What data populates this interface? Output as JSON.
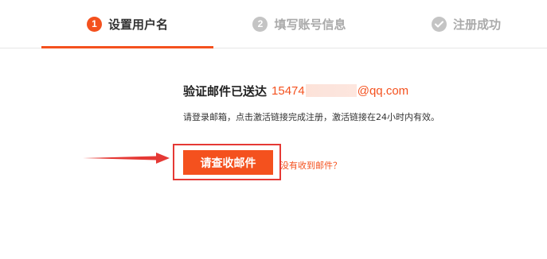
{
  "steps": [
    {
      "number": "1",
      "label": "设置用户名",
      "state": "active"
    },
    {
      "number": "2",
      "label": "填写账号信息",
      "state": "pending"
    },
    {
      "number": "",
      "label": "注册成功",
      "state": "pending"
    }
  ],
  "content": {
    "heading": "验证邮件已送达",
    "email_prefix": "15474",
    "email_suffix": "@qq.com",
    "description": "请登录邮箱，点击激活链接完成注册，激活链接在24小时内有效。",
    "check_mail_button": "请查收邮件",
    "no_mail_link": "没有收到邮件？"
  },
  "colors": {
    "accent": "#f4511e",
    "highlight": "#e53935",
    "inactive": "#c4c4c4"
  },
  "icons": {
    "step3": "check-circle-icon",
    "annotation": "arrow-right-icon"
  }
}
